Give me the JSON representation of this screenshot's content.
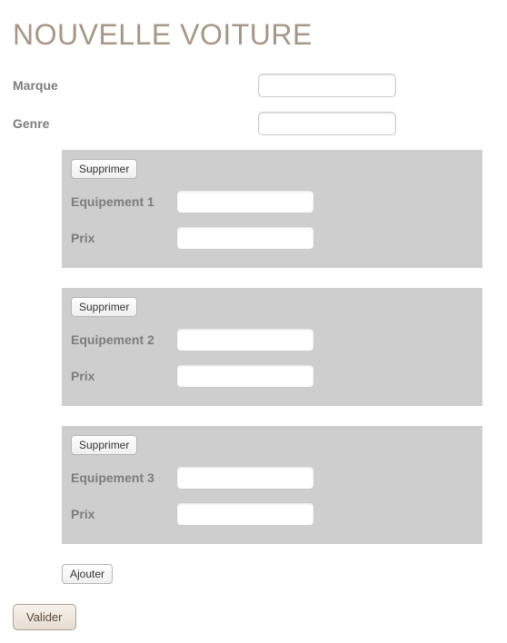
{
  "title": "NOUVELLE VOITURE",
  "fields": {
    "marque": {
      "label": "Marque",
      "value": ""
    },
    "genre": {
      "label": "Genre",
      "value": ""
    }
  },
  "cards": [
    {
      "delete_label": "Supprimer",
      "equip_label": "Equipement 1",
      "equip_value": "",
      "price_label": "Prix",
      "price_value": ""
    },
    {
      "delete_label": "Supprimer",
      "equip_label": "Equipement 2",
      "equip_value": "",
      "price_label": "Prix",
      "price_value": ""
    },
    {
      "delete_label": "Supprimer",
      "equip_label": "Equipement 3",
      "equip_value": "",
      "price_label": "Prix",
      "price_value": ""
    }
  ],
  "buttons": {
    "add": "Ajouter",
    "submit": "Valider"
  }
}
